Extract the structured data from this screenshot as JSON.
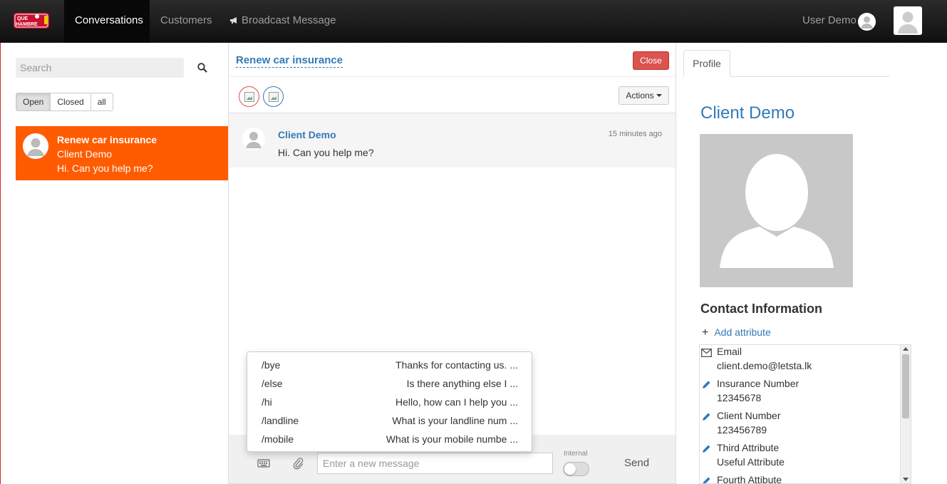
{
  "navbar": {
    "logo_text": "QUE HAMBRE",
    "items": [
      {
        "label": "Conversations",
        "active": true
      },
      {
        "label": "Customers",
        "active": false
      },
      {
        "label": "Broadcast Message",
        "active": false,
        "icon": "megaphone-icon"
      }
    ],
    "user_name": "User Demo"
  },
  "sidebar": {
    "search_placeholder": "Search",
    "filters": [
      {
        "label": "Open",
        "active": true
      },
      {
        "label": "Closed",
        "active": false
      },
      {
        "label": "all",
        "active": false
      }
    ],
    "conversations": [
      {
        "title": "Renew car insurance",
        "client": "Client Demo",
        "last_message": "Hi. Can you help me?"
      }
    ]
  },
  "conversation": {
    "title": "Renew car insurance",
    "close_label": "Close",
    "actions_label": "Actions",
    "messages": [
      {
        "author": "Client Demo",
        "time": "15 minutes ago",
        "text": "Hi. Can you help me?"
      }
    ],
    "composer": {
      "placeholder": "Enter a new message",
      "internal_label": "Internal",
      "send_label": "Send"
    },
    "canned_responses": [
      {
        "command": "/bye",
        "text": "Thanks for contacting us. ..."
      },
      {
        "command": "/else",
        "text": "Is there anything else I ..."
      },
      {
        "command": "/hi",
        "text": "Hello, how can I help you ..."
      },
      {
        "command": "/landline",
        "text": "What is your landline num ..."
      },
      {
        "command": "/mobile",
        "text": "What is your mobile numbe ..."
      }
    ]
  },
  "profile": {
    "tab_label": "Profile",
    "client_name": "Client Demo",
    "contact_title": "Contact Information",
    "add_attribute_label": "Add attribute",
    "attributes": [
      {
        "label": "Email",
        "value": "client.demo@letsta.lk",
        "icon": "envelope-icon"
      },
      {
        "label": "Insurance Number",
        "value": "12345678",
        "icon": "pencil-icon"
      },
      {
        "label": "Client Number",
        "value": "123456789",
        "icon": "pencil-icon"
      },
      {
        "label": "Third Attribute",
        "value": "Useful Attribute",
        "icon": "pencil-icon"
      },
      {
        "label": "Fourth Attibute",
        "value": "",
        "icon": "pencil-icon"
      }
    ]
  },
  "colors": {
    "accent": "#337ab7",
    "conversation_highlight": "#ff5b00",
    "close_button": "#d9534f",
    "navbar": "#1a1a1a"
  }
}
